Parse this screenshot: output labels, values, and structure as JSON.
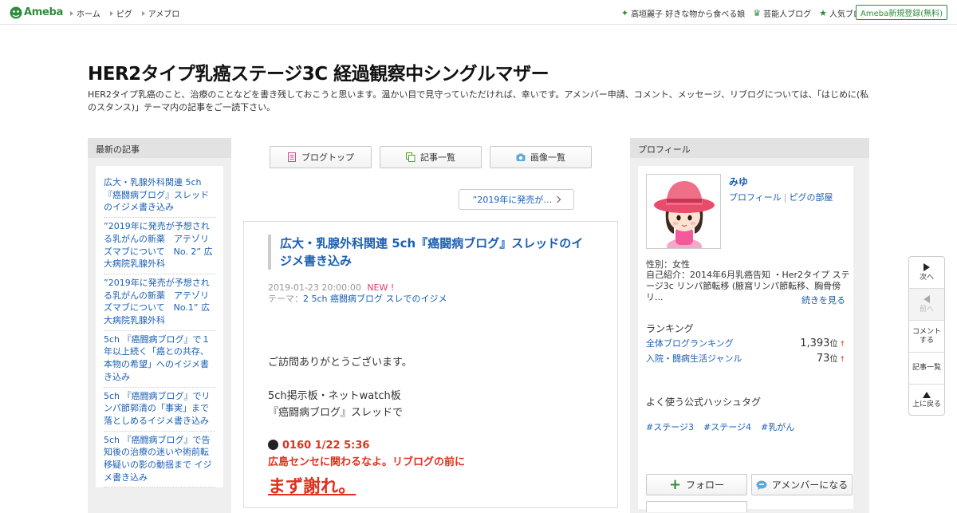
{
  "global_header": {
    "logo_text": "Ameba",
    "nav": [
      "ホーム",
      "ピグ",
      "アメブロ"
    ],
    "right_links": [
      {
        "icon": "sparkle-icon",
        "label": "高垣麗子 好きな物から食べる娘"
      },
      {
        "icon": "crown-icon",
        "label": "芸能人ブログ"
      },
      {
        "icon": "star-icon",
        "label": "人気ブログ"
      }
    ],
    "signup_label": "Ameba新規登録(無料)"
  },
  "blog": {
    "title": "HER2タイプ乳癌ステージ3C 経過観察中シングルマザー",
    "description": "HER2タイプ乳癌のこと、治療のことなどを書き残しておこうと思います。温かい目で見守っていただければ、幸いです。アメンバー申請、コメント、メッセージ、リブログについては、「はじめに(私のスタンス)」テーマ内の記事をご一読下さい。"
  },
  "left_sidebar": {
    "heading": "最新の記事",
    "recent_posts": [
      "広大・乳腺外科関連 5ch『癌闘病ブログ』スレッドのイジメ書き込み",
      "”2019年に発売が予想される乳がんの新薬　アテゾリズマブについて　No. 2” 広大病院乳腺外科",
      "”2019年に発売が予想される乳がんの新薬　アテゾリズマブについて　No.1” 広大病院乳腺外科",
      "5ch 『癌闘病ブログ』で１年以上続く「癌との共存、本物の希望」へのイジメ書き込み",
      "5ch 『癌闘病ブログ』でリンパ節郭清の「事実」まで落としめるイジメ書き込み",
      "5ch 『癌闘病ブログ』で告知後の治療の迷いや術前転移疑いの影の動揺まで イジメ書き込み"
    ]
  },
  "center": {
    "buttons": {
      "blog_top": "ブログトップ",
      "article_list": "記事一覧",
      "image_list": "画像一覧"
    },
    "prev_post_label": "”2019年に発売が…",
    "article": {
      "title": "広大・乳腺外科関連 5ch『癌闘病ブログ』スレッドのイジメ書き込み",
      "datetime": "2019-01-23 20:00:00",
      "new_badge": "NEW !",
      "theme_prefix": "テーマ：",
      "theme": "2 5ch 癌闘病ブログ スレでのイジメ",
      "body_line1": "ご訪問ありがとうございます。",
      "body_line2": "5ch掲示板・ネットwatch板",
      "body_line3": "『癌闘病ブログ』スレッドで",
      "red_line1": "0160 1/22 5:36",
      "red_line2": "広島センセに関わるなよ。リブログの前に",
      "big_line": "まず謝れ。"
    }
  },
  "right_sidebar": {
    "heading": "プロフィール",
    "name": "みゆ",
    "profile_link": "プロフィール",
    "pigg_link": "ピグの部屋",
    "gender": "性別：女性",
    "intro": "自己紹介：2014年6月乳癌告知 ・Her2タイプ ステージ3c リンパ節転移 (腋窩リンパ節転移、胸骨傍リ...",
    "read_more": "続きを見る",
    "ranking_heading": "ランキング",
    "rankings": [
      {
        "label": "全体ブログランキング",
        "value": "1,393",
        "unit": "位",
        "trend": "↑"
      },
      {
        "label": "入院・闘病生活ジャンル",
        "value": "73",
        "unit": "位",
        "trend": "↑"
      }
    ],
    "hashtag_heading": "よく使う公式ハッシュタグ",
    "hashtags": [
      "#ステージ3",
      "#ステージ4",
      "#乳がん"
    ],
    "follow_label": "フォロー",
    "amember_label": "アメンバーになる"
  },
  "side_nav": {
    "next": "次へ",
    "prev": "前へ",
    "comment_l1": "コメント",
    "comment_l2": "する",
    "article_list": "記事一覧",
    "to_top": "上に戻る"
  },
  "colors": {
    "ameba_green": "#2d8c3c",
    "link_blue": "#1a5fb4",
    "new_pink": "#e03a6e",
    "alert_red": "#e0301e"
  }
}
